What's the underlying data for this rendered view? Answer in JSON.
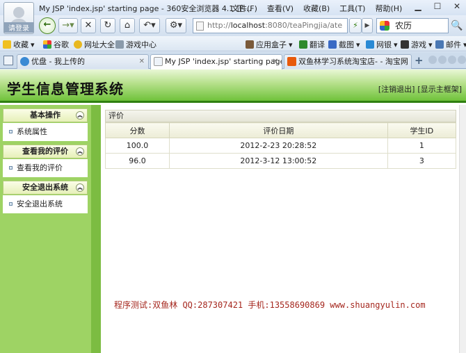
{
  "browser": {
    "avatar_label": "请登录",
    "window_title": "My JSP 'index.jsp' starting page - 360安全浏览器 4.1 正...",
    "menu": [
      "文件(F)",
      "查看(V)",
      "收藏(B)",
      "工具(T)",
      "帮助(H)"
    ],
    "url_scheme": "http://",
    "url_host": "localhost",
    "url_rest": ":8080/teaPingjia/ate",
    "search_value": "农历",
    "favorites": [
      {
        "label": "收藏",
        "icon": "star-icon"
      },
      {
        "label": "谷歌",
        "icon": "google-icon"
      },
      {
        "label": "网址大全",
        "icon": "web-directory-icon"
      },
      {
        "label": "游戏中心",
        "icon": "gamepad-icon"
      },
      {
        "label": "应用盒子",
        "icon": "app-box-icon"
      },
      {
        "label": "翻译",
        "icon": "translate-icon"
      },
      {
        "label": "截图",
        "icon": "scissors-icon"
      },
      {
        "label": "网银",
        "icon": "bank-icon"
      },
      {
        "label": "游戏",
        "icon": "game-icon"
      },
      {
        "label": "邮件",
        "icon": "mail-icon"
      }
    ],
    "tabs": [
      {
        "label": "优盘 - 我上传的",
        "active": false
      },
      {
        "label": "My JSP 'index.jsp' starting page",
        "active": true
      },
      {
        "label": "双鱼林学习系统淘宝店- - 淘宝网",
        "active": false
      }
    ]
  },
  "app": {
    "title": "学生信息管理系统",
    "logout_link": "[注销退出]",
    "frame_link": "[显示主框架]",
    "sidebar": [
      {
        "header": "基本操作",
        "item": "系统属性"
      },
      {
        "header": "查看我的评价",
        "item": "查看我的评价"
      },
      {
        "header": "安全退出系统",
        "item": "安全退出系统"
      }
    ],
    "panel_title": "评价",
    "columns": [
      "分数",
      "评价日期",
      "学生ID"
    ],
    "rows": [
      [
        "100.0",
        "2012-2-23 20:28:52",
        "1"
      ],
      [
        "96.0",
        "2012-3-12 13:00:52",
        "3"
      ]
    ],
    "footer": "程序测试:双鱼林 QQ:287307421 手机:13558690869 www.shuangyulin.com"
  },
  "colors": {
    "header_green": "#6fc23a",
    "sidebar_green": "#9ed364",
    "footer_red": "#a5271e"
  }
}
